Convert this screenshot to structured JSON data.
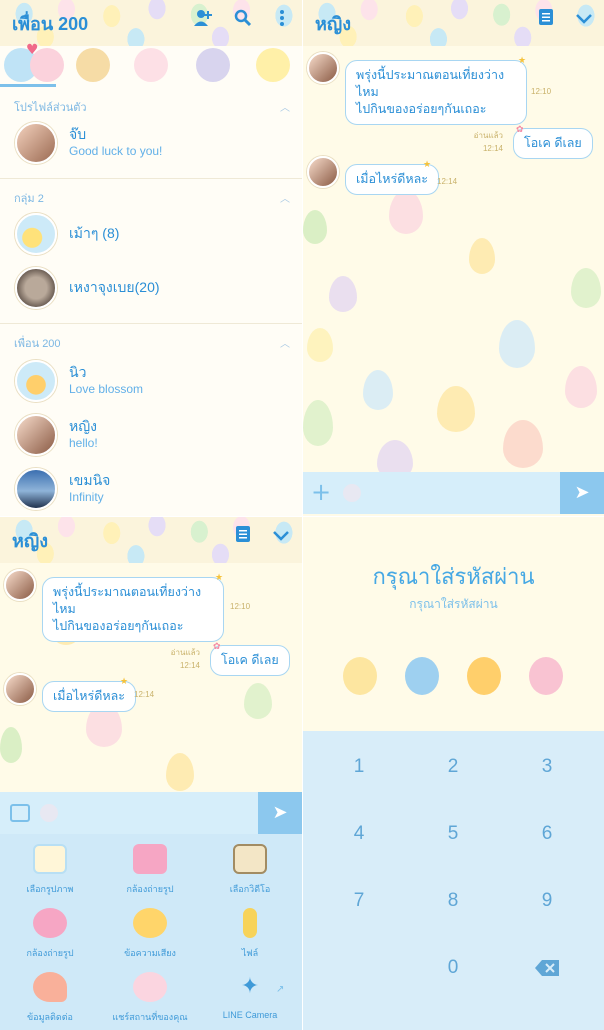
{
  "friends": {
    "header_title": "เพื่อน 200",
    "sections": {
      "profile": "โปรไฟล์ส่วนตัว",
      "groups": "กลุ่ม 2",
      "friends": "เพื่อน 200"
    },
    "me": {
      "name": "จ๊บ",
      "status": "Good luck to you!"
    },
    "groups": [
      {
        "name": "เม้าๆ (8)"
      },
      {
        "name": "เหงาจุงเบย(20)"
      }
    ],
    "friend_list": [
      {
        "name": "นิว",
        "status": "Love blossom"
      },
      {
        "name": "หญิง",
        "status": "hello!"
      },
      {
        "name": "เขมนิจ",
        "status": "Infinity"
      }
    ]
  },
  "chat": {
    "title": "หญิง",
    "msg1": {
      "line1": "พรุ่งนี้ประมาณตอนเที่ยงว่างไหม",
      "line2": "ไปกินของอร่อยๆกันเถอะ",
      "time": "12:10"
    },
    "msg2": {
      "text": "โอเค ดีเลย",
      "read": "อ่านแล้ว",
      "time": "12:14"
    },
    "msg3": {
      "text": "เมื่อไหร่ดีหละ",
      "time": "12:14"
    }
  },
  "attach_menu": [
    {
      "label": "เลือกรูปภาพ",
      "icon": "photo-icon"
    },
    {
      "label": "กล้องถ่ายรูป",
      "icon": "camera-icon"
    },
    {
      "label": "เลือกวิดีโอ",
      "icon": "video-icon"
    },
    {
      "label": "กล้องถ่ายรูป",
      "icon": "video-camera-icon"
    },
    {
      "label": "ข้อความเสียง",
      "icon": "voice-icon"
    },
    {
      "label": "ไฟล์",
      "icon": "paperclip-icon"
    },
    {
      "label": "ข้อมูลติดต่อ",
      "icon": "contact-icon"
    },
    {
      "label": "แชร์สถานที่ของคุณ",
      "icon": "location-icon"
    },
    {
      "label": "LINE Camera",
      "icon": "magic-wand-icon"
    }
  ],
  "passcode": {
    "title": "กรุณาใส่รหัสผ่าน",
    "subtitle": "กรุณาใส่รหัสผ่าน",
    "keys": [
      "1",
      "2",
      "3",
      "4",
      "5",
      "6",
      "7",
      "8",
      "9",
      "0"
    ]
  },
  "colors": {
    "accent": "#2b8fd6",
    "bubble_border": "#a8d6f2",
    "send": "#8cc8ee",
    "keypad": "#d8edf9"
  }
}
